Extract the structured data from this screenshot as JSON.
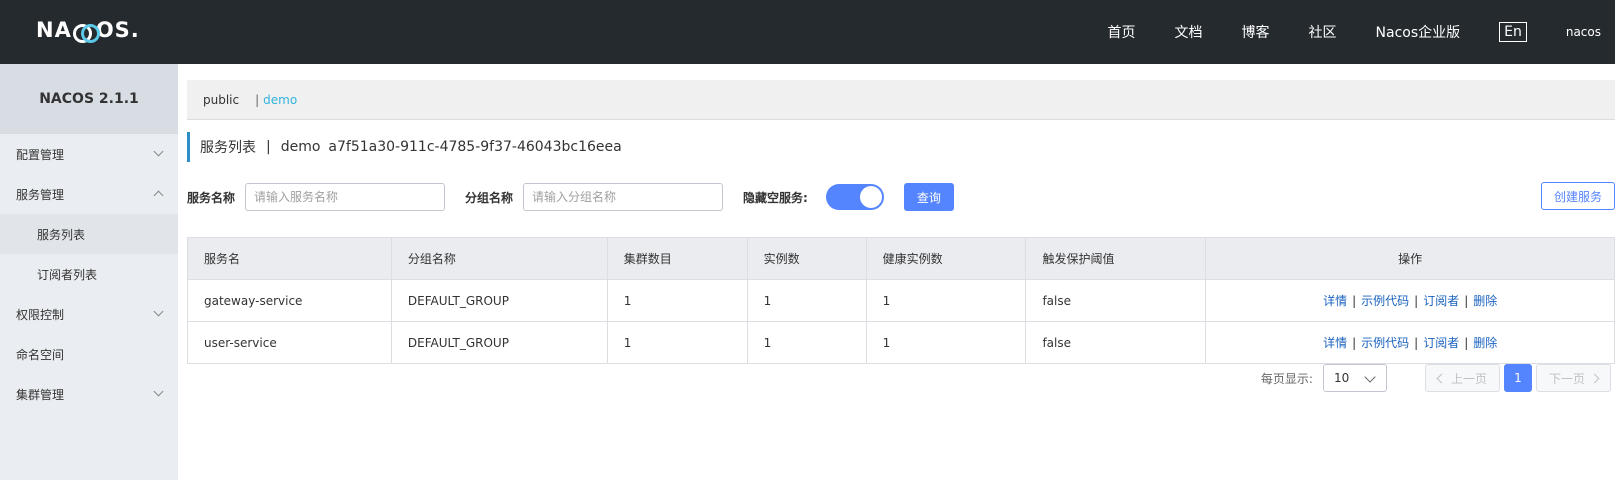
{
  "header": {
    "logo": "NACOS",
    "nav": [
      "首页",
      "文档",
      "博客",
      "社区",
      "Nacos企业版"
    ],
    "lang": "En",
    "user": "nacos"
  },
  "sidebar": {
    "title": "NACOS 2.1.1",
    "items": [
      {
        "label": "配置管理",
        "chevron": "down"
      },
      {
        "label": "服务管理",
        "chevron": "up"
      },
      {
        "label": "服务列表",
        "sub": true,
        "active": true
      },
      {
        "label": "订阅者列表",
        "sub": true
      },
      {
        "label": "权限控制",
        "chevron": "down"
      },
      {
        "label": "命名空间"
      },
      {
        "label": "集群管理",
        "chevron": "down"
      }
    ]
  },
  "namespace": {
    "public": "public",
    "sep": "|",
    "current": "demo"
  },
  "title": {
    "main": "服务列表",
    "sep": "|",
    "ns_name": "demo",
    "ns_id": "a7f51a30-911c-4785-9f37-46043bc16eea"
  },
  "filters": {
    "service_label": "服务名称",
    "service_placeholder": "请输入服务名称",
    "group_label": "分组名称",
    "group_placeholder": "请输入分组名称",
    "hide_empty_label": "隐藏空服务:",
    "query_button": "查询",
    "create_button": "创建服务"
  },
  "table": {
    "columns": [
      "服务名",
      "分组名称",
      "集群数目",
      "实例数",
      "健康实例数",
      "触发保护阈值",
      "操作"
    ],
    "rows": [
      {
        "name": "gateway-service",
        "group": "DEFAULT_GROUP",
        "clusters": "1",
        "instances": "1",
        "healthy": "1",
        "threshold": "false"
      },
      {
        "name": "user-service",
        "group": "DEFAULT_GROUP",
        "clusters": "1",
        "instances": "1",
        "healthy": "1",
        "threshold": "false"
      }
    ],
    "ops": {
      "detail": "详情",
      "sample": "示例代码",
      "subscribers": "订阅者",
      "delete": "删除",
      "sep": "|"
    }
  },
  "pagination": {
    "label": "每页显示:",
    "page_size": "10",
    "prev": "上一页",
    "current": "1",
    "next": "下一页"
  },
  "colors": {
    "topbar": "#252a2f",
    "primary": "#5584ff",
    "link": "#1a62bf",
    "ns_active": "#33b3dc"
  }
}
